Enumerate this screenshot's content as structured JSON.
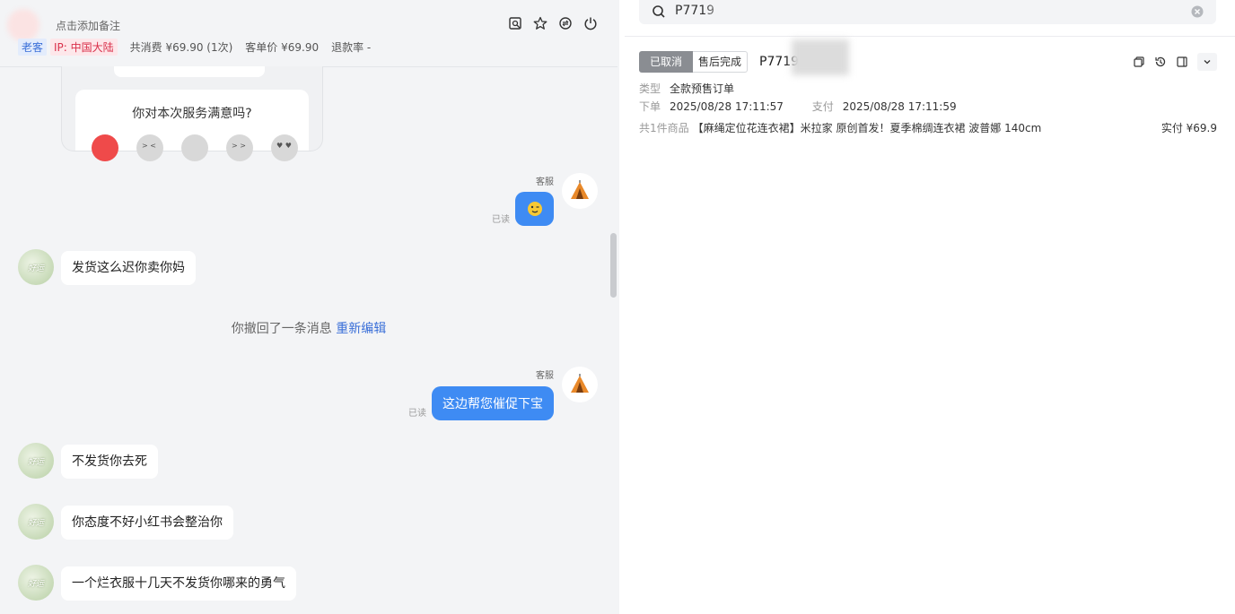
{
  "header": {
    "note": "点击添加备注",
    "tag_old": "老客",
    "tag_ip": "IP: 中国大陆",
    "total_spend": "共消费 ¥69.90 (1次)",
    "unit_price": "客单价 ¥69.90",
    "refund_rate": "退款率 -"
  },
  "survey": {
    "question": "你对本次服务满意吗?"
  },
  "chat": {
    "agent_label": "客服",
    "read_label": "已读",
    "msg_customer_1": "发货这么迟你卖你妈",
    "system_msg": "你撤回了一条消息",
    "system_link": "重新编辑",
    "msg_agent_2": "这边帮您催促下宝",
    "msg_customer_2": "不发货你去死",
    "msg_customer_3": "你态度不好小红书会整治你",
    "msg_customer_4": "一个烂衣服十几天不发货你哪来的勇气"
  },
  "order": {
    "search_value": "P7719",
    "status_cancelled": "已取消",
    "status_aftersale": "售后完成",
    "order_id": "P7719",
    "type_label": "类型",
    "type_value": "全款预售订单",
    "placed_label": "下单",
    "placed_value": "2025/08/28 17:11:57",
    "paid_label": "支付",
    "paid_value": "2025/08/28 17:11:59",
    "goods_count": "共1件商品",
    "goods_name": "【麻绳定位花连衣裙】米拉家 原创首发！夏季棉绸连衣裙 波普娜 140cm",
    "actual_paid": "实付 ¥69.9"
  },
  "colors": {
    "accent": "#3e8bf3",
    "link": "#3a6fd8",
    "ip_tag": "#d9304a"
  }
}
